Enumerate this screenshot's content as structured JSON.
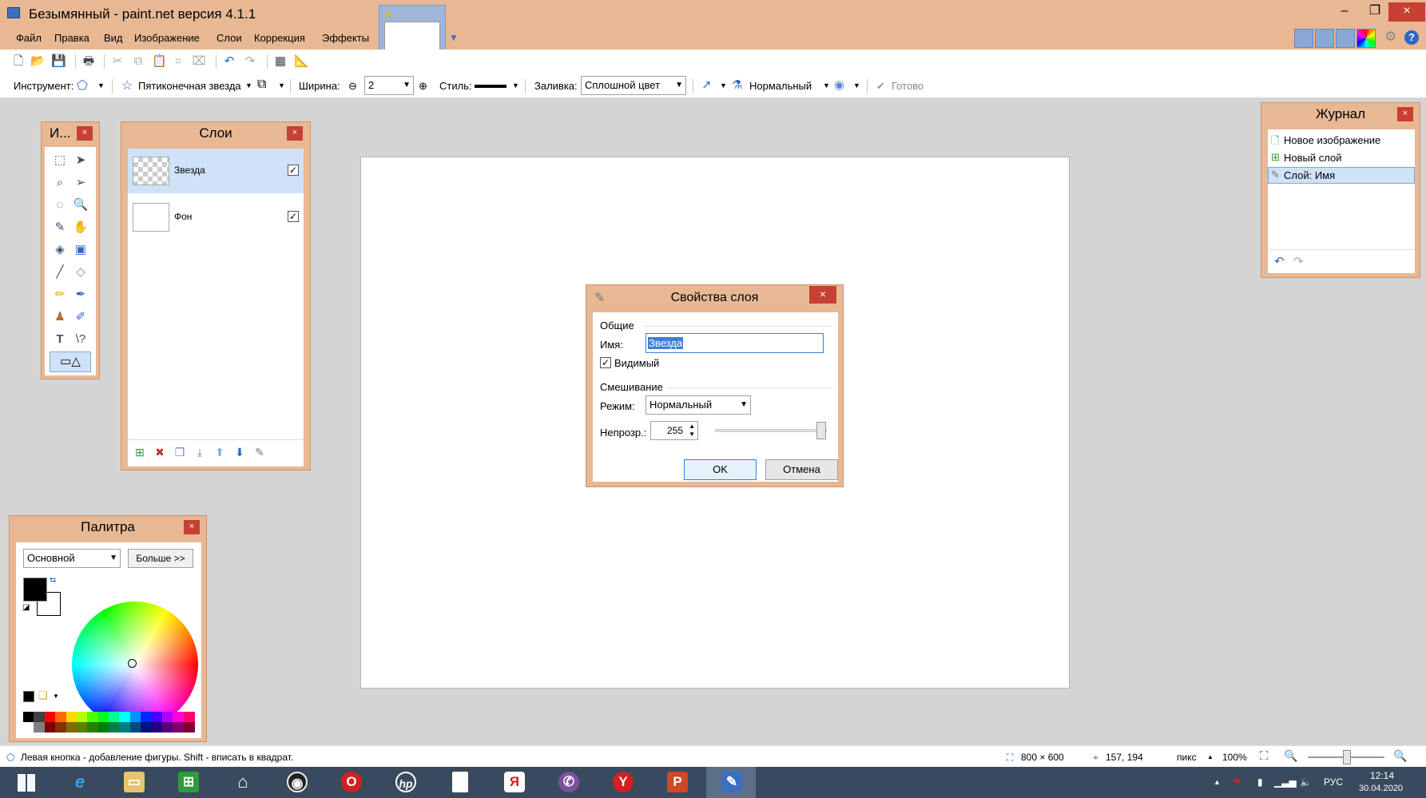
{
  "window": {
    "title": "Безымянный - paint.net версия 4.1.1",
    "min_glyph": "–",
    "restore_glyph": "❐",
    "close_glyph": "×"
  },
  "menu": {
    "items": [
      "Файл",
      "Правка",
      "Вид",
      "Изображение",
      "Слои",
      "Коррекция",
      "Эффекты"
    ]
  },
  "toolbar2": {
    "tool_label": "Инструмент:",
    "shape_name": "Пятиконечная звезда",
    "width_label": "Ширина:",
    "width_value": "2",
    "style_label": "Стиль:",
    "fill_label": "Заливка:",
    "fill_value": "Сплошной цвет",
    "blend_value": "Нормальный",
    "done_label": "Готово"
  },
  "tools_panel": {
    "title": "И...",
    "close": "×"
  },
  "layers_panel": {
    "title": "Слои",
    "close": "×",
    "layers": [
      {
        "name": "Звезда",
        "visible": true,
        "selected": true
      },
      {
        "name": "Фон",
        "visible": true,
        "selected": false
      }
    ]
  },
  "history_panel": {
    "title": "Журнал",
    "close": "×",
    "items": [
      "Новое изображение",
      "Новый слой",
      "Слой: Имя"
    ]
  },
  "dialog": {
    "title": "Свойства слоя",
    "close": "×",
    "general_heading": "Общие",
    "name_label": "Имя:",
    "name_value": "Звезда",
    "visible_label": "Видимый",
    "blending_heading": "Смешивание",
    "mode_label": "Режим:",
    "mode_value": "Нормальный",
    "opacity_label": "Непрозр.:",
    "opacity_value": "255",
    "ok": "OK",
    "cancel": "Отмена"
  },
  "palette": {
    "title": "Палитра",
    "close": "×",
    "preset": "Основной",
    "more": "Больше >>",
    "primary_color": "#000000",
    "secondary_color": "#ffffff"
  },
  "status": {
    "hint": "Левая кнопка - добавление фигуры. Shift - вписать в квадрат.",
    "image_size": "800 × 600",
    "cursor_pos": "157, 194",
    "units": "пикс",
    "zoom": "100%"
  },
  "taskbar": {
    "lang": "РУС",
    "time": "12:14",
    "date": "30.04.2020"
  },
  "colors": {
    "chrome": "#e8b894",
    "close_red": "#c84031",
    "selection": "#cfe2f8",
    "taskbar": "#394a5e"
  }
}
